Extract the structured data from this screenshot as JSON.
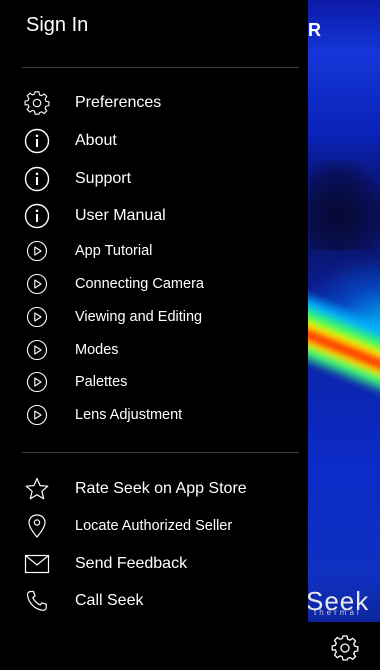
{
  "header": {
    "title": "Sign In",
    "partial_overlay_letter": "R"
  },
  "menu": {
    "primary": [
      {
        "label": "Preferences",
        "icon": "gear-icon"
      },
      {
        "label": "About",
        "icon": "info-icon"
      },
      {
        "label": "Support",
        "icon": "info-icon"
      },
      {
        "label": "User Manual",
        "icon": "info-icon"
      }
    ],
    "tutorials": [
      {
        "label": "App Tutorial",
        "icon": "play-circle-icon"
      },
      {
        "label": "Connecting Camera",
        "icon": "play-circle-icon"
      },
      {
        "label": "Viewing and Editing",
        "icon": "play-circle-icon"
      },
      {
        "label": "Modes",
        "icon": "play-circle-icon"
      },
      {
        "label": "Palettes",
        "icon": "play-circle-icon"
      },
      {
        "label": "Lens Adjustment",
        "icon": "play-circle-icon"
      }
    ],
    "secondary": [
      {
        "label": "Rate Seek on App Store",
        "icon": "star-icon"
      },
      {
        "label": "Locate Authorized Seller",
        "icon": "location-pin-icon"
      },
      {
        "label": "Send Feedback",
        "icon": "envelope-icon"
      },
      {
        "label": "Call Seek",
        "icon": "phone-icon"
      }
    ]
  },
  "background": {
    "logo_text": "Seek",
    "logo_sub": "thermal"
  },
  "colors": {
    "drawer_bg": "#000000",
    "text": "#ffffff",
    "divider": "#3a3a3a"
  }
}
